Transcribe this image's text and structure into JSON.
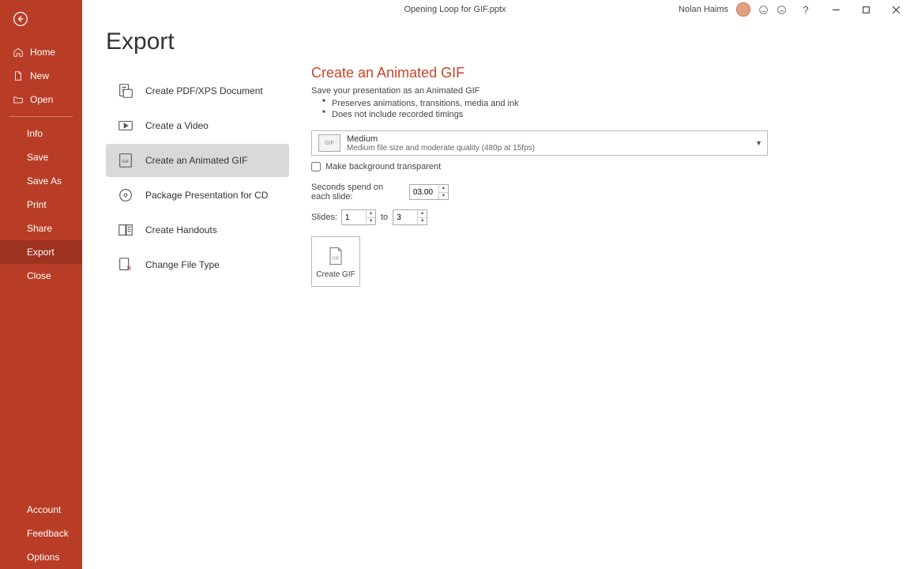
{
  "titlebar": {
    "filename": "Opening Loop for GIF.pptx",
    "username": "Nolan Haims"
  },
  "sidebar": {
    "home": "Home",
    "new": "New",
    "open": "Open",
    "info": "Info",
    "save": "Save",
    "save_as": "Save As",
    "print": "Print",
    "share": "Share",
    "export": "Export",
    "close": "Close",
    "account": "Account",
    "feedback": "Feedback",
    "options": "Options"
  },
  "export": {
    "title": "Export",
    "options": {
      "pdf": "Create PDF/XPS Document",
      "video": "Create a Video",
      "gif": "Create an Animated GIF",
      "cd": "Package Presentation for CD",
      "handouts": "Create Handouts",
      "filetype": "Change File Type"
    }
  },
  "panel": {
    "heading": "Create an Animated GIF",
    "subtitle": "Save your presentation as an Animated GIF",
    "bullet1": "Preserves animations, transitions, media and ink",
    "bullet2": "Does not include recorded timings",
    "quality": {
      "title": "Medium",
      "detail": "Medium file size and moderate quality (480p at 15fps)"
    },
    "transparent_label": "Make background transparent",
    "seconds_label": "Seconds spend on each slide:",
    "seconds_value": "03.00",
    "slides_label": "Slides:",
    "slides_from": "1",
    "slides_to_label": "to",
    "slides_to": "3",
    "create_button": "Create GIF"
  }
}
